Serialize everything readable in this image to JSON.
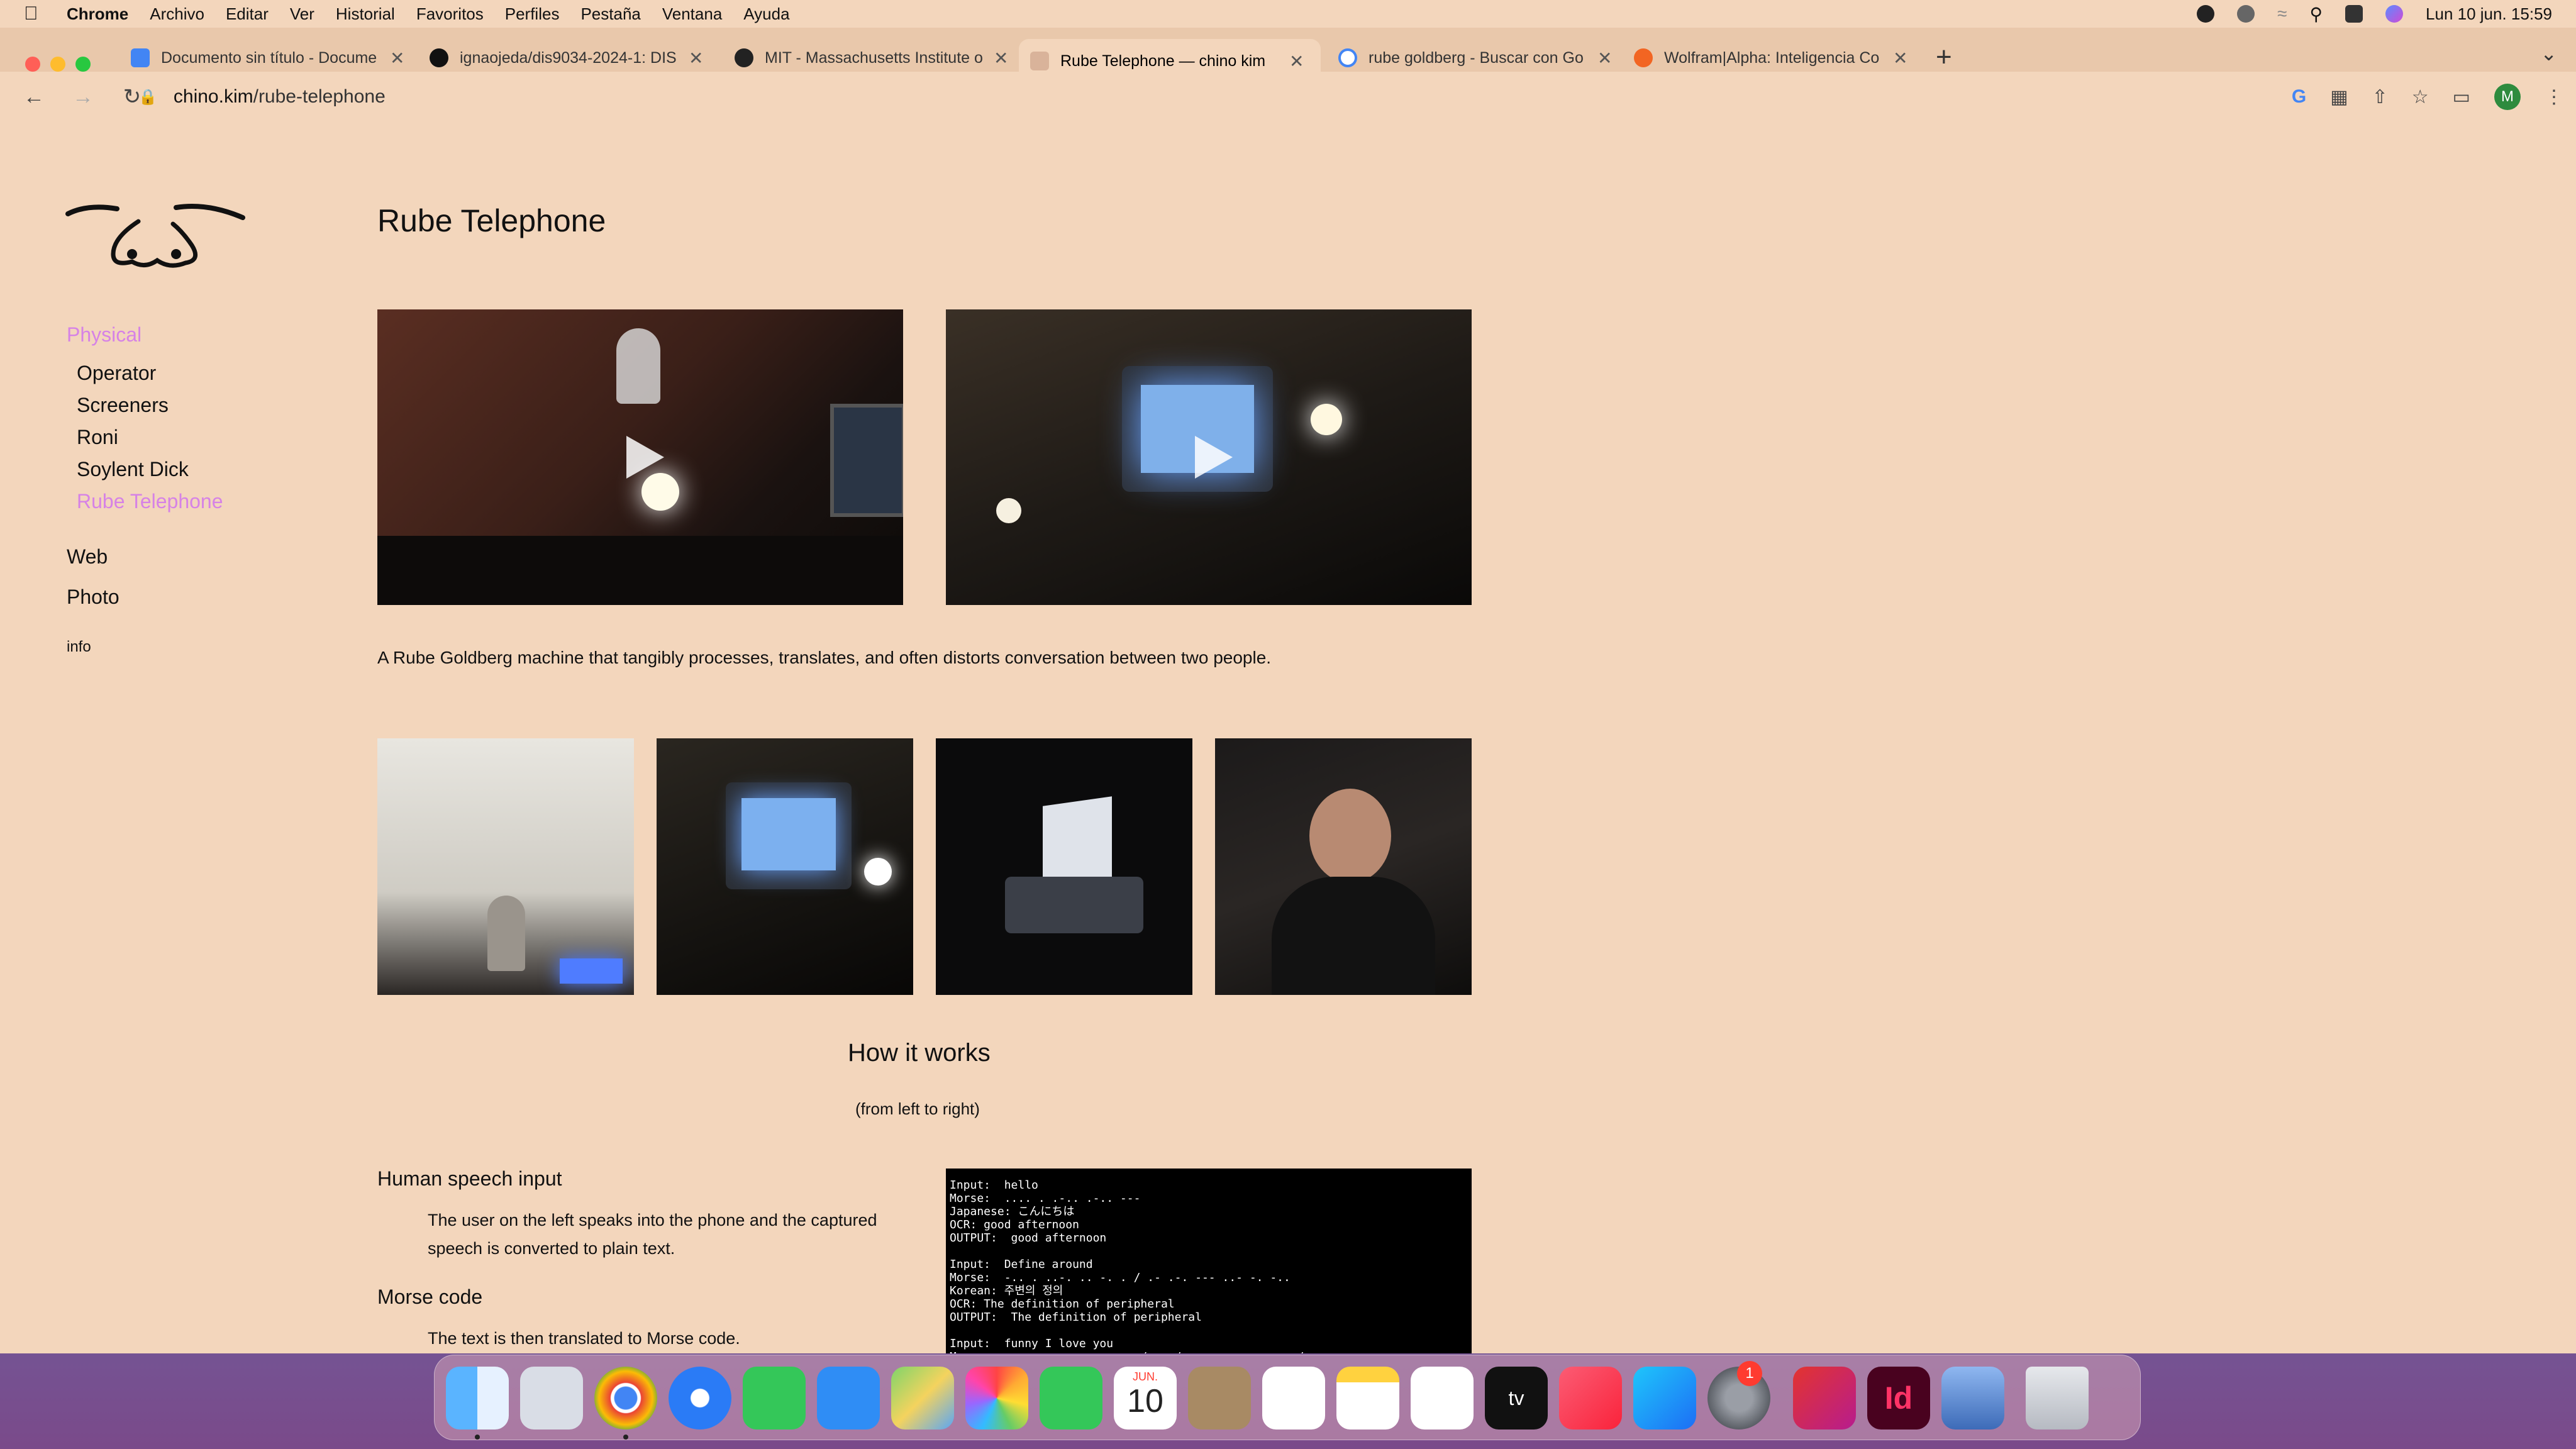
{
  "menubar": {
    "app": "Chrome",
    "items": [
      "Archivo",
      "Editar",
      "Ver",
      "Historial",
      "Favoritos",
      "Perfiles",
      "Pestaña",
      "Ventana",
      "Ayuda"
    ],
    "clock": "Lun 10 jun.  15:59"
  },
  "tabs": [
    {
      "title": "Documento sin título - Docume"
    },
    {
      "title": "ignaojeda/dis9034-2024-1: DIS"
    },
    {
      "title": "MIT - Massachusetts Institute o"
    },
    {
      "title": "Rube Telephone — chino kim"
    },
    {
      "title": "rube goldberg - Buscar con Go"
    },
    {
      "title": "Wolfram|Alpha: Inteligencia Co"
    }
  ],
  "url": {
    "host": "chino.kim",
    "path": "/rube-telephone"
  },
  "avatar_letter": "M",
  "sidebar": {
    "category": "Physical",
    "items": [
      "Operator",
      "Screeners",
      "Roni",
      "Soylent Dick",
      "Rube Telephone"
    ],
    "top_items": [
      "Web",
      "Photo"
    ],
    "info": "info"
  },
  "page": {
    "title": "Rube Telephone",
    "description": "A Rube Goldberg machine that tangibly processes, translates, and often distorts conversation between two people.",
    "how_title": "How it works",
    "how_sub": "(from left to right)",
    "sections": [
      {
        "heading": "Human speech input",
        "text": "The user on the left speaks into the phone and the captured speech is converted to plain text."
      },
      {
        "heading": "Morse code",
        "text": "The text is then translated to Morse code."
      }
    ],
    "terminal": "Input:  hello\nMorse:  .... . .-.. .-.. ---\nJapanese: こんにちは\nOCR: good afternoon\nOUTPUT:  good afternoon\n\nInput:  Define around\nMorse:  -.. . ..-. .. -. . / .- .-. --- ..- -. -..\nKorean: 주변의 정의\nOCR: The definition of peripheral\nOUTPUT:  The definition of peripheral\n\nInput:  funny I love you\nMorse:  ..-. ..- -. -. -.-- / .. / .-.. --- ...- . / -.-- --- ..-\nHindi: अच्छा बात है कि मैं तुमसे प्यार करता हूँ"
  },
  "dock": {
    "calendar_month": "JUN.",
    "calendar_day": "10",
    "settings_badge": "1"
  }
}
